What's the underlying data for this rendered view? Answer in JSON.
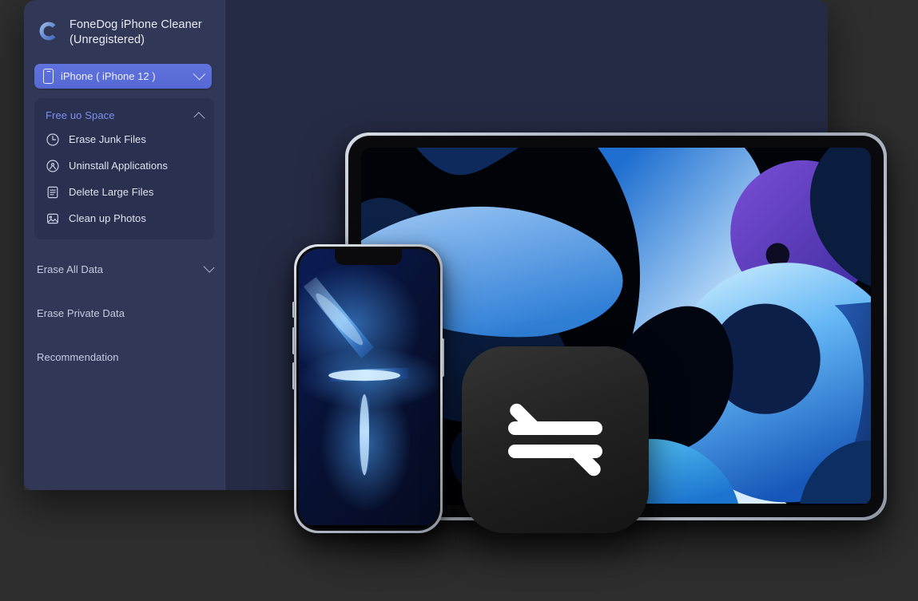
{
  "app": {
    "title": "FoneDog iPhone  Cleaner (Unregistered)",
    "logo_icon": "fonedog-c-logo-icon",
    "window_bg": "#262b45",
    "sidebar_bg": "#313756",
    "accent": "#5f72dd",
    "group_accent": "#7e90f0",
    "page_bg": "#2e2e2e"
  },
  "device_selector": {
    "icon": "phone-icon",
    "value": "iPhone ( iPhone 12 )",
    "chevron_icon": "chevron-down-icon"
  },
  "sidebar": {
    "groups": [
      {
        "label": "Free uo Space",
        "expanded": true,
        "chevron_icon": "chevron-up-icon",
        "items": [
          {
            "label": "Erase Junk Files",
            "icon": "clock-icon"
          },
          {
            "label": "Uninstall Applications",
            "icon": "uninstall-app-icon"
          },
          {
            "label": "Delete Large Files",
            "icon": "document-lines-icon"
          },
          {
            "label": "Clean up Photos",
            "icon": "photo-icon"
          }
        ]
      }
    ],
    "rows": [
      {
        "label": "Erase All Data",
        "chevron_icon": "chevron-down-icon",
        "has_chevron": true
      },
      {
        "label": "Erase Private Data",
        "has_chevron": false
      },
      {
        "label": "Recommendation",
        "has_chevron": false
      }
    ]
  },
  "main": {
    "devices": [
      {
        "name": "ipad",
        "wallpaper": "abstract-blue-purple-shapes"
      },
      {
        "name": "iphone",
        "wallpaper": "blue-light-streaks"
      },
      {
        "name": "transfer-app-icon",
        "glyph": "two-way-arrows-icon"
      }
    ]
  }
}
